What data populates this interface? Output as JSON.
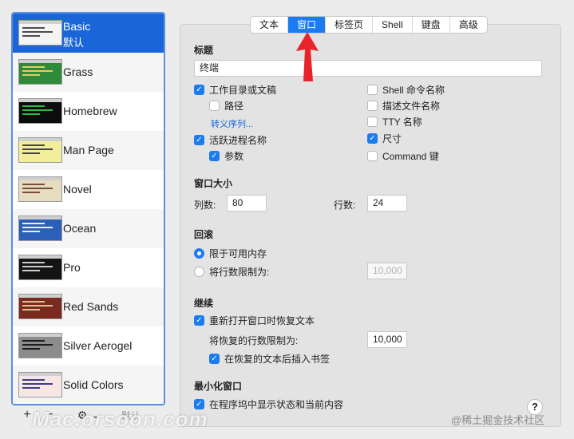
{
  "tabs": [
    "文本",
    "窗口",
    "标签页",
    "Shell",
    "键盘",
    "高级"
  ],
  "profiles": [
    {
      "name": "Basic",
      "sub": "默认",
      "bg": "#f4f4f4",
      "fg": "#3a3a3a"
    },
    {
      "name": "Grass",
      "bg": "#2f8a3a",
      "fg": "#f6d36b"
    },
    {
      "name": "Homebrew",
      "bg": "#0c0c0c",
      "fg": "#2fd14a"
    },
    {
      "name": "Man Page",
      "bg": "#f3ee9c",
      "fg": "#333333"
    },
    {
      "name": "Novel",
      "bg": "#e6dcc0",
      "fg": "#6b3e2a"
    },
    {
      "name": "Ocean",
      "bg": "#2c5fb8",
      "fg": "#ffffff"
    },
    {
      "name": "Pro",
      "bg": "#141414",
      "fg": "#e0e0e0"
    },
    {
      "name": "Red Sands",
      "bg": "#7a2a1e",
      "fg": "#e8d4a0"
    },
    {
      "name": "Silver Aerogel",
      "bg": "#8c8c8c",
      "fg": "#111111"
    },
    {
      "name": "Solid Colors",
      "bg": "#f6e6e6",
      "fg": "#2a2a7a"
    }
  ],
  "sidebar_controls": {
    "add": "+",
    "remove": "−",
    "gear": "⚙",
    "chevron": "⌄",
    "default": "默认"
  },
  "title_section": {
    "header": "标题",
    "value": "终端"
  },
  "title_options_left": [
    {
      "label": "工作目录或文稿",
      "checked": true
    },
    {
      "label": "路径",
      "checked": false
    },
    {
      "label": "活跃进程名称",
      "checked": true
    },
    {
      "label": "参数",
      "checked": true
    }
  ],
  "escape_link": "转义序列...",
  "title_options_right": [
    {
      "label": "Shell 命令名称",
      "checked": false
    },
    {
      "label": "描述文件名称",
      "checked": false
    },
    {
      "label": "TTY 名称",
      "checked": false
    },
    {
      "label": "尺寸",
      "checked": true
    },
    {
      "label": "Command 键",
      "checked": false
    }
  ],
  "window_size": {
    "header": "窗口大小",
    "cols_label": "列数:",
    "cols": "80",
    "rows_label": "行数:",
    "rows": "24"
  },
  "scrollback": {
    "header": "回滚",
    "opt1": "限于可用内存",
    "opt2": "将行数限制为:",
    "limit": "10,000"
  },
  "resume": {
    "header": "继续",
    "restore": "重新打开窗口时恢复文本",
    "lines_label": "将恢复的行数限制为:",
    "lines": "10,000",
    "bookmark": "在恢复的文本后插入书签"
  },
  "minimize": {
    "header": "最小化窗口",
    "show": "在程序坞中显示状态和当前内容"
  },
  "help": "?",
  "watermark": "Mac.orsoon.com",
  "credit": "@稀土掘金技术社区",
  "colors": {
    "accent": "#1a7cf0",
    "selection": "#1a66d9",
    "arrow": "#e8232a"
  }
}
